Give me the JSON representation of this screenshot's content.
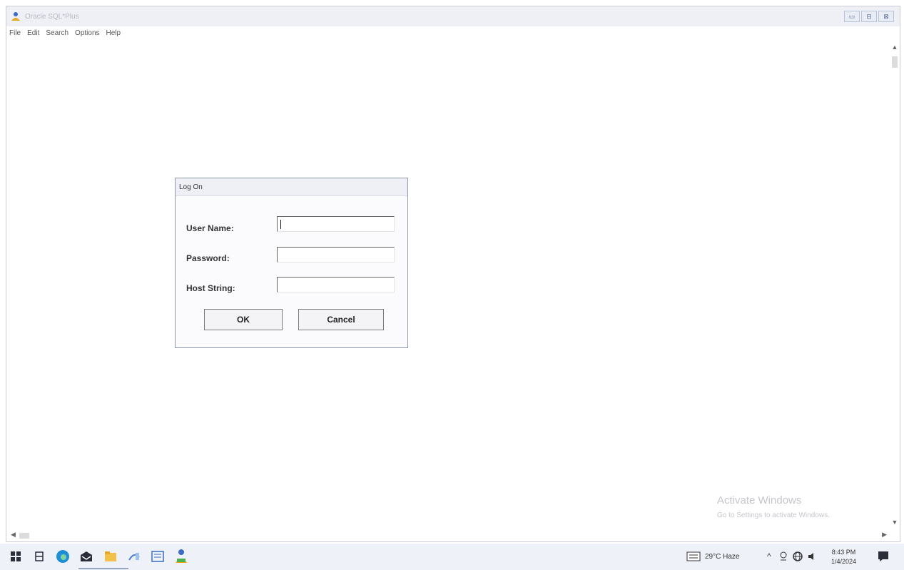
{
  "window": {
    "title": "Oracle SQL*Plus",
    "menu": [
      "File",
      "Edit",
      "Search",
      "Options",
      "Help"
    ]
  },
  "dialog": {
    "title": "Log On",
    "fields": [
      {
        "label": "User Name:",
        "value": ""
      },
      {
        "label": "Password:",
        "value": ""
      },
      {
        "label": "Host String:",
        "value": ""
      }
    ],
    "ok_label": "OK",
    "cancel_label": "Cancel"
  },
  "watermark": {
    "line1": "Activate Windows",
    "line2": "Go to Settings to activate Windows."
  },
  "taskbar": {
    "icons": [
      "windows-start-icon",
      "task-view-icon",
      "edge-icon",
      "mail-icon",
      "file-explorer-icon",
      "sql-developer-icon",
      "forms-icon",
      "sqlplus-icon"
    ],
    "weather": "29°C  Haze",
    "time": "8:43 PM",
    "date": "1/4/2024"
  },
  "colors": {
    "accent": "#2f6fd6",
    "taskbar_bg": "#eef1f8"
  }
}
